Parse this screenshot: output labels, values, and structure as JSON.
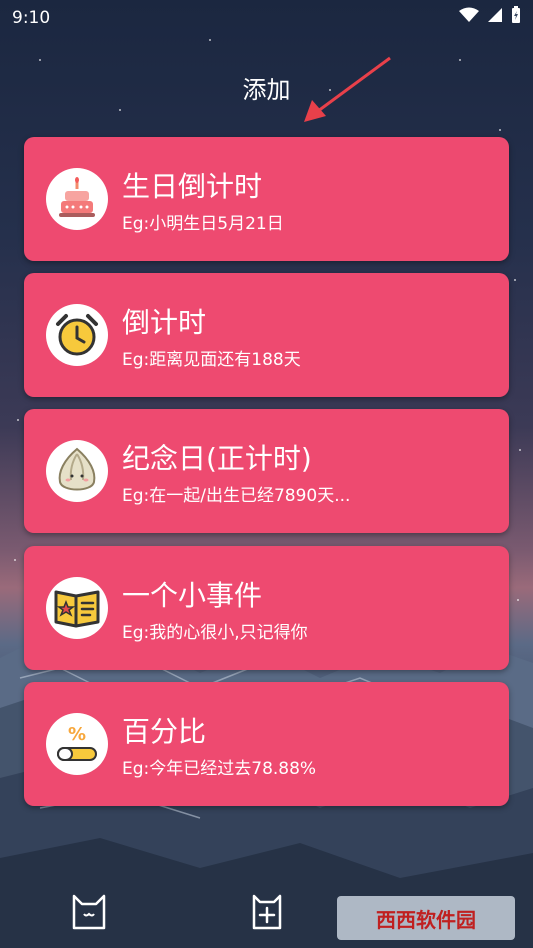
{
  "status": {
    "time": "9:10"
  },
  "page": {
    "title": "添加"
  },
  "cards": [
    {
      "title": "生日倒计时",
      "subtitle": "Eg:小明生日5月21日",
      "icon": "birthday-cake-icon"
    },
    {
      "title": "倒计时",
      "subtitle": "Eg:距离见面还有188天",
      "icon": "alarm-clock-icon"
    },
    {
      "title": "纪念日(正计时)",
      "subtitle": "Eg:在一起/出生已经7890天...",
      "icon": "seed-icon"
    },
    {
      "title": "一个小事件",
      "subtitle": "Eg:我的心很小,只记得你",
      "icon": "star-note-icon"
    },
    {
      "title": "百分比",
      "subtitle": "Eg:今年已经过去78.88%",
      "icon": "percent-icon"
    }
  ],
  "colors": {
    "card": "#ee4a70",
    "accent_yellow": "#f7c93c"
  }
}
